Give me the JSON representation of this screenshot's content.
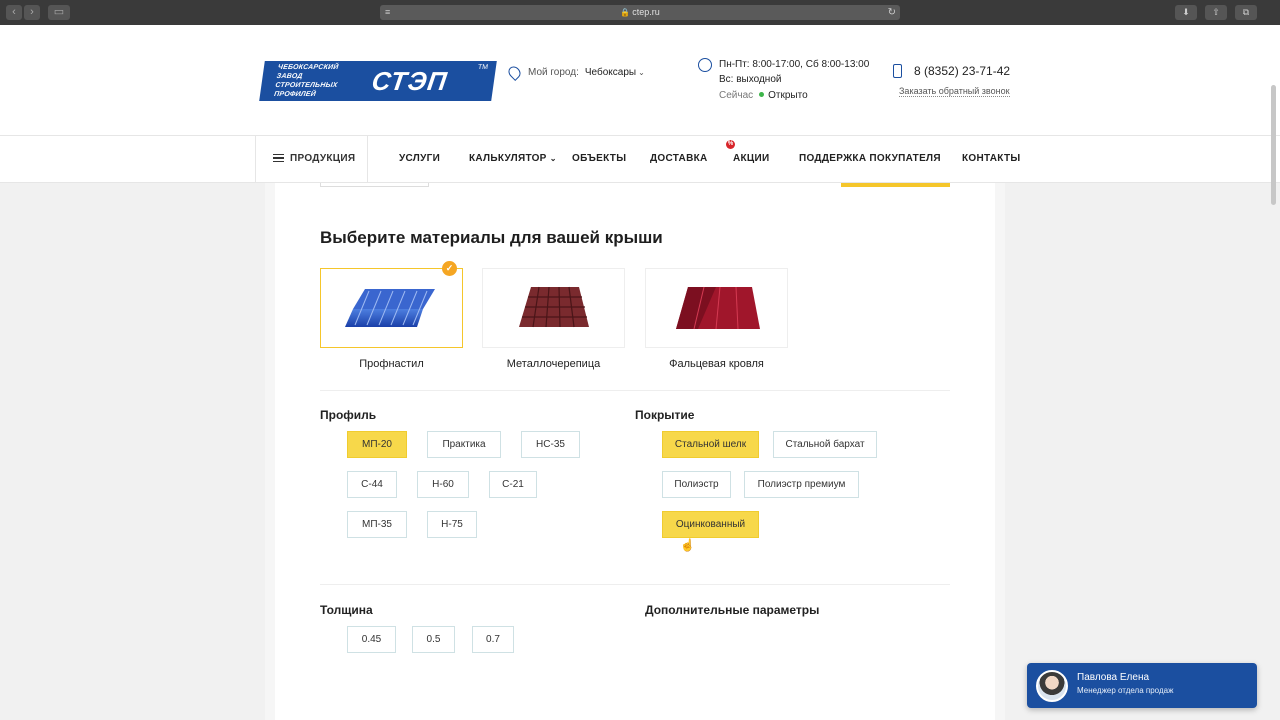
{
  "browser": {
    "url": "ctep.ru",
    "lock_icon": "lock-icon"
  },
  "header": {
    "logo_small": "ЧЕБОКСАРСКИЙ ЗАВОД СТРОИТЕЛЬНЫХ ПРОФИЛЕЙ",
    "logo_big": "СТЭП",
    "logo_tm": "TM",
    "city_label": "Мой город:",
    "city_value": "Чебоксары",
    "hours_line1": "Пн-Пт: 8:00-17:00, Сб 8:00-13:00",
    "hours_line2": "Вс: выходной",
    "status_label": "Сейчас",
    "status_value": "Открыто",
    "phone": "8 (8352) 23-71-42",
    "callback": "Заказать обратный звонок"
  },
  "nav": {
    "products": "ПРОДУКЦИЯ",
    "items": [
      "УСЛУГИ",
      "КАЛЬКУЛЯТОР",
      "ОБЪЕКТЫ",
      "ДОСТАВКА",
      "АКЦИИ",
      "ПОДДЕРЖКА ПОКУПАТЕЛЯ",
      "КОНТАКТЫ"
    ],
    "badge": "%"
  },
  "main": {
    "title": "Выберите материалы для вашей крыши",
    "materials": [
      {
        "label": "Профнастил",
        "selected": true
      },
      {
        "label": "Металлочерепица",
        "selected": false
      },
      {
        "label": "Фальцевая кровля",
        "selected": false
      }
    ],
    "profile": {
      "title": "Профиль",
      "options": [
        "МП-20",
        "Практика",
        "НС-35",
        "С-44",
        "Н-60",
        "С-21",
        "МП-35",
        "Н-75"
      ],
      "selected": "МП-20"
    },
    "coating": {
      "title": "Покрытие",
      "options": [
        "Стальной шелк",
        "Стальной бархат",
        "Полиэстр",
        "Полиэстр премиум",
        "Оцинкованный"
      ],
      "selected": [
        "Стальной шелк",
        "Оцинкованный"
      ]
    },
    "thickness": {
      "title": "Толщина",
      "options": [
        "0.45",
        "0.5",
        "0.7"
      ]
    },
    "extra_title": "Дополнительные параметры"
  },
  "chat": {
    "name": "Павлова Елена",
    "role": "Менеджер отдела продаж"
  },
  "colors": {
    "brand": "#1b4fa0",
    "accent": "#f7d84a",
    "badge": "#d8262b",
    "open": "#3db54a"
  }
}
